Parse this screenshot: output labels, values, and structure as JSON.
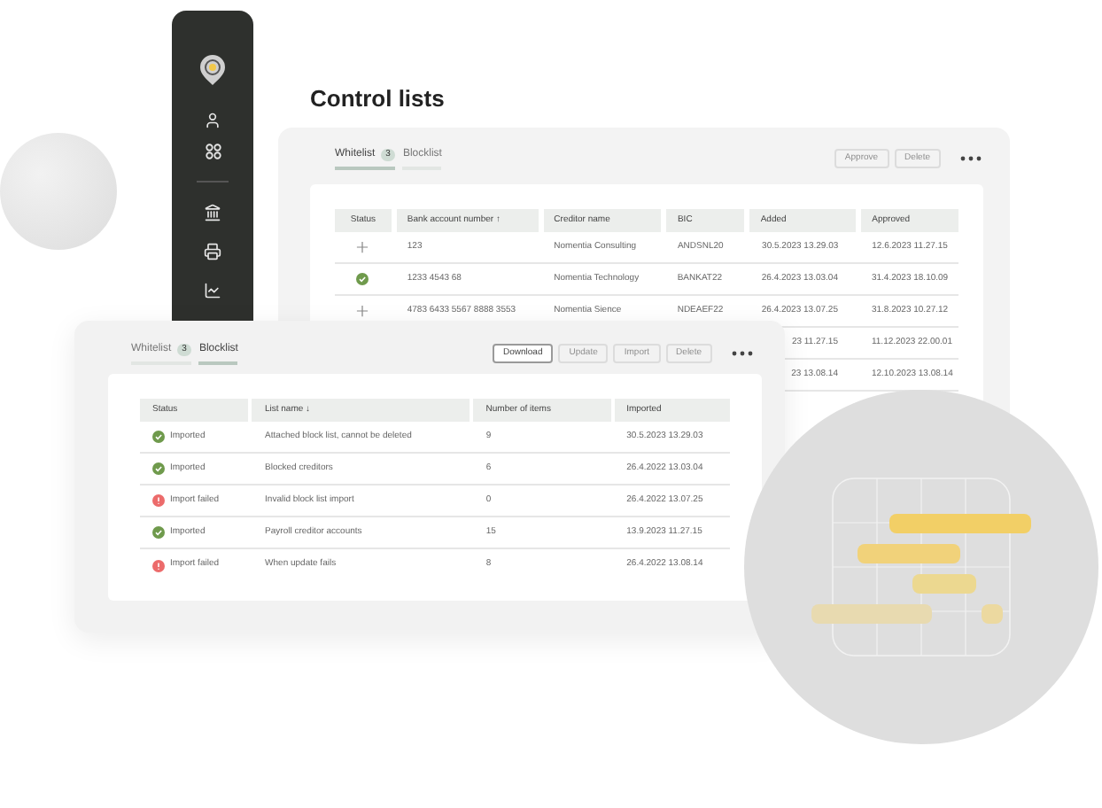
{
  "title": "Control lists",
  "whitelist_card": {
    "tabs": [
      {
        "label": "Whitelist",
        "badge": "3",
        "selected": true
      },
      {
        "label": "Blocklist",
        "selected": false
      }
    ],
    "buttons": [
      {
        "label": "Approve",
        "disabled": true
      },
      {
        "label": "Delete",
        "disabled": true
      }
    ],
    "columns": [
      "Status",
      "Bank account number ↑",
      "Creditor name",
      "BIC",
      "Added",
      "Approved"
    ],
    "rows": [
      {
        "kind": "pending",
        "account": "123",
        "creditor": "Nomentia Consulting",
        "bic": "ANDSNL20",
        "added": "30.5.2023 13.29.03",
        "approved": "12.6.2023 11.27.15"
      },
      {
        "kind": "approved",
        "account": "1233 4543 68",
        "creditor": "Nomentia Technology",
        "bic": "BANKAT22",
        "added": "26.4.2023 13.03.04",
        "approved": "31.4.2023 18.10.09"
      },
      {
        "kind": "pending",
        "account": "4783 6433 5567 8888 3553",
        "creditor": "Nomentia Sience",
        "bic": "NDEAEF22",
        "added": "26.4.2023 13.07.25",
        "approved": "31.8.2023 10.27.12"
      },
      {
        "added": "23 11.27.15",
        "approved": "11.12.2023 22.00.01"
      },
      {
        "added": "23 13.08.14",
        "approved": "12.10.2023 13.08.14"
      }
    ]
  },
  "blocklist_card": {
    "tabs": [
      {
        "label": "Whitelist",
        "badge": "3",
        "selected": false
      },
      {
        "label": "Blocklist",
        "selected": true
      }
    ],
    "buttons": [
      {
        "label": "Download",
        "disabled": false
      },
      {
        "label": "Update",
        "disabled": true
      },
      {
        "label": "Import",
        "disabled": true
      },
      {
        "label": "Delete",
        "disabled": true
      }
    ],
    "columns": [
      "Status",
      "List name ↓",
      "Number of items",
      "Imported"
    ],
    "rows": [
      {
        "kind": "imported",
        "status": "Imported",
        "name": "Attached block list, cannot be deleted",
        "items": "9",
        "imported": "30.5.2023 13.29.03"
      },
      {
        "kind": "imported",
        "status": "Imported",
        "name": "Blocked creditors",
        "items": "6",
        "imported": "26.4.2022 13.03.04"
      },
      {
        "kind": "failed",
        "status": "Import failed",
        "name": "Invalid block list import",
        "items": "0",
        "imported": "26.4.2022 13.07.25"
      },
      {
        "kind": "imported",
        "status": "Imported",
        "name": "Payroll creditor accounts",
        "items": "15",
        "imported": "13.9.2023 11.27.15"
      },
      {
        "kind": "failed",
        "status": "Import failed",
        "name": "When update fails",
        "items": "8",
        "imported": "26.4.2022 13.08.14"
      }
    ]
  }
}
